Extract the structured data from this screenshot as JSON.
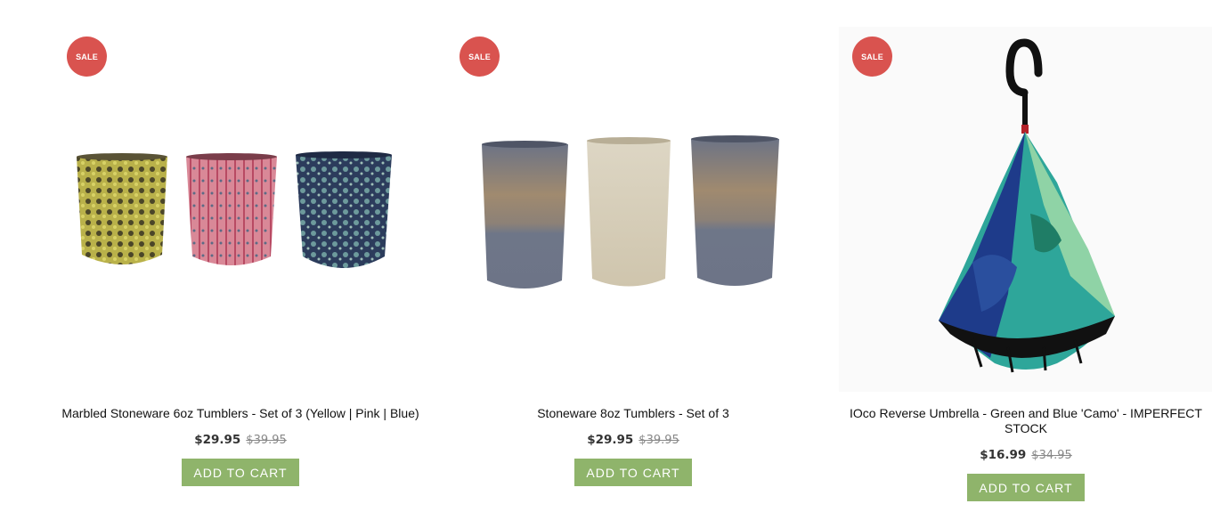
{
  "products": [
    {
      "badge": "SALE",
      "title": "Marbled Stoneware 6oz Tumblers - Set of 3 (Yellow | Pink | Blue)",
      "price": "$29.95",
      "old_price": "$39.95",
      "button": "ADD TO CART"
    },
    {
      "badge": "SALE",
      "title": "Stoneware 8oz Tumblers - Set of 3",
      "price": "$29.95",
      "old_price": "$39.95",
      "button": "ADD TO CART"
    },
    {
      "badge": "SALE",
      "title": "IOco Reverse Umbrella - Green and Blue 'Camo' - IMPERFECT STOCK",
      "price": "$16.99",
      "old_price": "$34.95",
      "button": "ADD TO CART"
    }
  ],
  "colors": {
    "sale_badge": "#d9534f",
    "button": "#8fb46b"
  }
}
